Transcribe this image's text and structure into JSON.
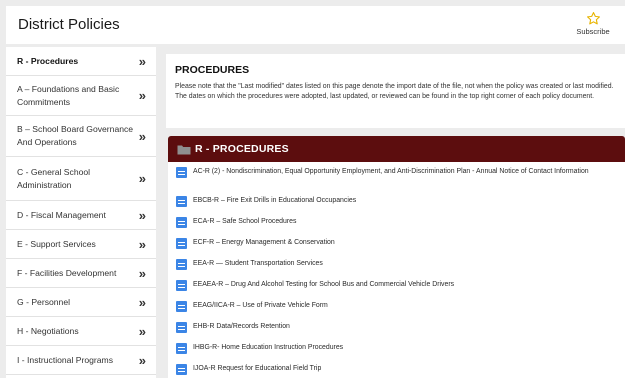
{
  "header": {
    "title": "District Policies",
    "subscribe_label": "Subscribe"
  },
  "sidebar": {
    "items": [
      {
        "label": "R - Procedures",
        "chevron": "»"
      },
      {
        "label": "A – Foundations and Basic Commitments",
        "chevron": "»"
      },
      {
        "label": "B – School Board Governance And Operations",
        "chevron": "»"
      },
      {
        "label": "C - General School Administration",
        "chevron": "»"
      },
      {
        "label": "D - Fiscal Management",
        "chevron": "»"
      },
      {
        "label": "E - Support Services",
        "chevron": "»"
      },
      {
        "label": "F - Facilities Development",
        "chevron": "»"
      },
      {
        "label": "G - Personnel",
        "chevron": "»"
      },
      {
        "label": "H - Negotiations",
        "chevron": "»"
      },
      {
        "label": "I - Instructional Programs",
        "chevron": "»"
      }
    ]
  },
  "notice": {
    "title": "PROCEDURES",
    "text": "Please note that the \"Last modified\" dates listed on this page denote the import date of the file, not when the policy was created or last modified. The dates on which the procedures were adopted, last updated, or reviewed can be found in the top right corner of each policy document."
  },
  "section": {
    "title": "R - PROCEDURES"
  },
  "documents": [
    "AC-R (2) - Nondiscrimination, Equal Opportunity Employment, and Anti-Discrimination Plan - Annual Notice of Contact Information",
    "EBCB-R – Fire Exit Drills in Educational Occupancies",
    "ECA-R – Safe School Procedures",
    "ECF-R – Energy Management & Conservation",
    "EEA-R — Student Transportation Services",
    "EEAEA-R – Drug And Alcohol Testing for School Bus and Commercial Vehicle Drivers",
    "EEAG/IICA-R – Use of Private Vehicle Form",
    "EHB-R Data/Records Retention",
    "IHBG-R- Home Education Instruction Procedures",
    "IJOA-R Request for Educational Field Trip"
  ],
  "colors": {
    "section_bar": "#5c0d0e",
    "doc_icon": "#3b85e6",
    "subscribe_star": "#e8b400"
  },
  "icons": {
    "subscribe": "star-outline-icon",
    "folder": "folder-icon",
    "document": "document-icon",
    "chevron": "double-chevron-right-icon"
  }
}
